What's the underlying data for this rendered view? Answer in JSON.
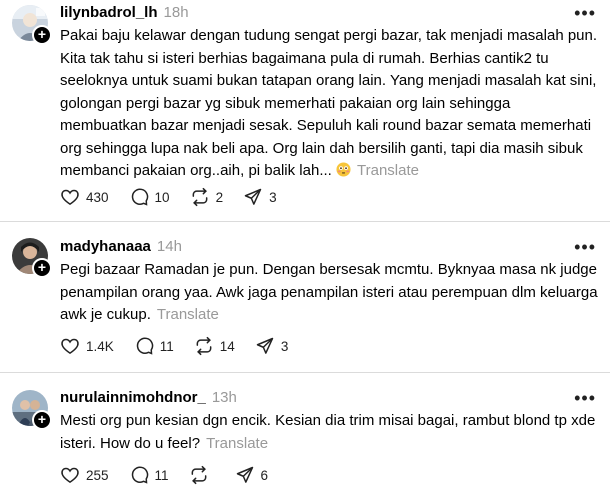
{
  "posts": [
    {
      "username": "lilynbadrol_lh",
      "time": "18h",
      "lines": [
        "Pakai baju kelawar dengan tudung sengat pergi bazar, tak menjadi masalah pun.",
        "Kita tak tahu si isteri berhias bagaimana pula di rumah. Berhias cantik2 tu",
        "seeloknya untuk suami bukan tatapan orang lain. Yang menjadi masalah kat sini,",
        "golongan pergi bazar yg sibuk memerhati pakaian org lain sehingga",
        "membuatkan bazar menjadi sesak. Sepuluh kali round bazar semata memerhati",
        "org sehingga lupa nak beli apa. Org lain dah bersilih ganti, tapi dia masih sibuk",
        "membanci pakaian org..aih, pi balik lah..."
      ],
      "translate": "Translate",
      "likes": "430",
      "comments": "10",
      "reposts": "2",
      "shares": "3"
    },
    {
      "username": "madyhanaaa",
      "time": "14h",
      "lines": [
        "Pegi bazaar Ramadan je pun. Dengan bersesak mcmtu. Byknyaa masa nk judge",
        "penampilan orang yaa. Awk jaga penampilan isteri atau perempuan dlm keluarga",
        "awk je cukup."
      ],
      "translate": "Translate",
      "likes": "1.4K",
      "comments": "11",
      "reposts": "14",
      "shares": "3"
    },
    {
      "username": "nurulainnimohdnor_",
      "time": "13h",
      "lines": [
        "Mesti org pun kesian dgn encik. Kesian dia trim misai bagai, rambut blond tp xde",
        "isteri. How do u feel?"
      ],
      "translate": "Translate",
      "likes": "255",
      "comments": "11",
      "reposts": "",
      "shares": "6"
    }
  ],
  "icons": {
    "like": "heart-icon",
    "comment": "comment-icon",
    "repost": "repost-icon",
    "share": "share-icon",
    "more": "more-icon",
    "follow": "plus-icon",
    "emoji": "flushed-face-emoji"
  },
  "colors": {
    "muted": "#999999",
    "divider": "#dbdbdb"
  }
}
